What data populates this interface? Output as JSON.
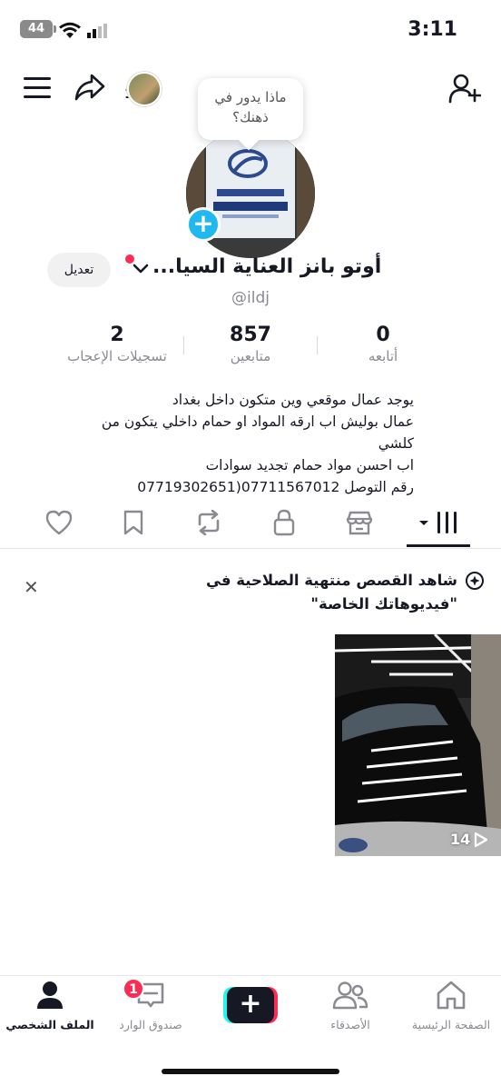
{
  "status_bar": {
    "time": "3:11",
    "battery": "44"
  },
  "header": {
    "story_count": "1"
  },
  "profile": {
    "avatar_prompt": "ماذا يدور في ذهنك؟",
    "edit_label": "تعديل",
    "display_name": "أوتو بانز العناية السيا...",
    "username": "@ildj",
    "stats": {
      "following": {
        "value": "0",
        "label": "أتابعه"
      },
      "followers": {
        "value": "857",
        "label": "متابعين"
      },
      "likes": {
        "value": "2",
        "label": "تسجيلات الإعجاب"
      }
    },
    "bio": [
      "يوجد عمال موقعي وين متكون داخل بغداد",
      "عمال بوليش اب ارقه المواد او حمام داخلي يتكون من كلشي",
      "اب احسن مواد حمام تجديد سوادات",
      "رقم التوصل 07711567012(07719302651"
    ]
  },
  "tabs": [
    "videos-grid",
    "shop",
    "private",
    "reposts",
    "saved",
    "liked"
  ],
  "banner": {
    "text": "شاهد القصص منتهية الصلاحية في \"فيديوهاتك الخاصة\""
  },
  "videos": [
    {
      "views": "14"
    }
  ],
  "bottom_nav": {
    "home": "الصفحة الرئيسية",
    "friends": "الأصدقاء",
    "inbox": "صندوق الوارد",
    "inbox_badge": "1",
    "profile": "الملف الشخصي"
  },
  "colors": {
    "accent": "#fe2c55",
    "cyan": "#25f4ee",
    "blue_badge": "#20b8f0"
  }
}
